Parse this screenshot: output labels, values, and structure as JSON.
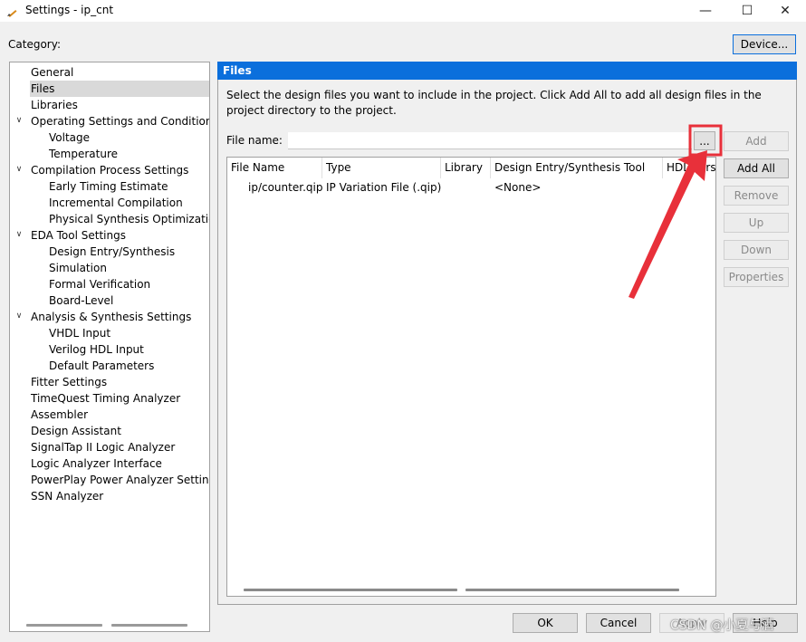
{
  "window": {
    "title": "Settings - ip_cnt",
    "minimize": "—",
    "maximize": "☐",
    "close": "✕"
  },
  "category_label": "Category:",
  "device_button": "Device...",
  "tree": {
    "items": [
      {
        "label": "General"
      },
      {
        "label": "Files"
      },
      {
        "label": "Libraries"
      },
      {
        "label": "Operating Settings and Conditions"
      },
      {
        "label": "Voltage"
      },
      {
        "label": "Temperature"
      },
      {
        "label": "Compilation Process Settings"
      },
      {
        "label": "Early Timing Estimate"
      },
      {
        "label": "Incremental Compilation"
      },
      {
        "label": "Physical Synthesis Optimizations"
      },
      {
        "label": "EDA Tool Settings"
      },
      {
        "label": "Design Entry/Synthesis"
      },
      {
        "label": "Simulation"
      },
      {
        "label": "Formal Verification"
      },
      {
        "label": "Board-Level"
      },
      {
        "label": "Analysis & Synthesis Settings"
      },
      {
        "label": "VHDL Input"
      },
      {
        "label": "Verilog HDL Input"
      },
      {
        "label": "Default Parameters"
      },
      {
        "label": "Fitter Settings"
      },
      {
        "label": "TimeQuest Timing Analyzer"
      },
      {
        "label": "Assembler"
      },
      {
        "label": "Design Assistant"
      },
      {
        "label": "SignalTap II Logic Analyzer"
      },
      {
        "label": "Logic Analyzer Interface"
      },
      {
        "label": "PowerPlay Power Analyzer Settings"
      },
      {
        "label": "SSN Analyzer"
      }
    ]
  },
  "panel": {
    "title": "Files",
    "description": "Select the design files you want to include in the project. Click Add All to add all design files in the project directory to the project.",
    "file_name_label": "File name:",
    "file_name_value": "",
    "browse_label": "...",
    "table": {
      "columns": [
        "File Name",
        "Type",
        "Library",
        "Design Entry/Synthesis Tool",
        "HDL Version"
      ],
      "rows": [
        {
          "file_name": "ip/counter.qip",
          "type": "IP Variation File (.qip)",
          "library": "",
          "tool": "<None>",
          "hdl": ""
        }
      ]
    },
    "buttons": {
      "add": "Add",
      "add_all": "Add All",
      "remove": "Remove",
      "up": "Up",
      "down": "Down",
      "properties": "Properties"
    }
  },
  "footer": {
    "ok": "OK",
    "cancel": "Cancel",
    "apply": "Apply",
    "help": "Help"
  },
  "watermark": "CSDN @小夏与酒",
  "colors": {
    "header_blue": "#0b6fdc",
    "annotation_red": "#e8303a"
  }
}
